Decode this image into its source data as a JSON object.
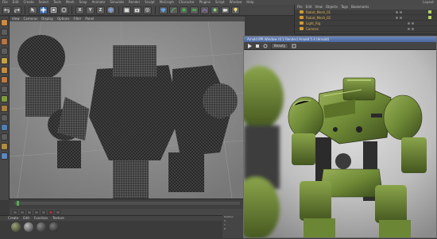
{
  "app": {
    "menu": [
      "File",
      "Edit",
      "Create",
      "Select",
      "Tools",
      "Mesh",
      "Snap",
      "Animate",
      "Simulate",
      "Render",
      "Sculpt",
      "MoGraph",
      "Character",
      "Plugins",
      "Script",
      "Window",
      "Help"
    ],
    "layout_label": "Layout:"
  },
  "toolbar": {
    "axis_labels": [
      "X",
      "Y",
      "Z"
    ]
  },
  "object_manager": {
    "menu": [
      "File",
      "Edit",
      "View",
      "Objects",
      "Tags",
      "Bookmarks"
    ],
    "objects": [
      {
        "name": "Robot_Mesh_01"
      },
      {
        "name": "Robot_Mesh_02"
      },
      {
        "name": "Light_Rig"
      },
      {
        "name": "Camera"
      }
    ]
  },
  "viewport": {
    "menu": [
      "View",
      "Cameras",
      "Display",
      "Options",
      "Filter",
      "Panel"
    ]
  },
  "render_window": {
    "title": "Arnold IPR Window (0.1 Render) Arnold 5.4 (Arnold)",
    "toolbar_box": "Beauty"
  },
  "material_manager": {
    "menu": [
      "Create",
      "Edit",
      "Function",
      "Texture"
    ]
  },
  "coordinates": {
    "labels": [
      "Position",
      "Size",
      "Rotation",
      "X",
      "Y",
      "Z"
    ]
  },
  "colors": {
    "robot_green": "#6f8a36",
    "selection_orange": "#d49a2a",
    "timeline_green": "#4fb24f"
  }
}
